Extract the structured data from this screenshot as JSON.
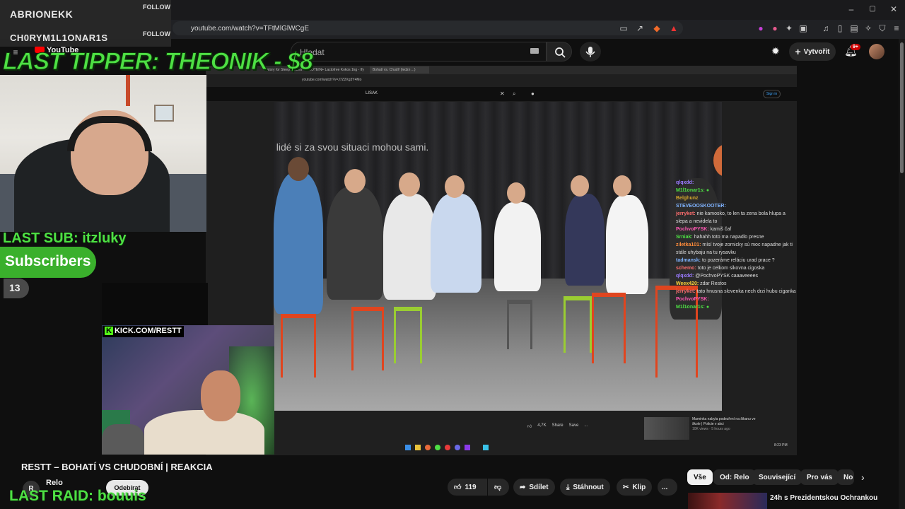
{
  "browser": {
    "url": "youtube.com/watch?v=TFtMlGlWCgE",
    "window_controls": [
      "–",
      "▢",
      "✕"
    ]
  },
  "overlay": {
    "follows": [
      {
        "name": "ABRIONEKK",
        "label": "FOLLOW"
      },
      {
        "name": "CH0RYM1L1ONAR1S",
        "label": "FOLLOW"
      }
    ],
    "last_tipper": "LAST TIPPER: THEONIK - $8",
    "last_sub": "LAST SUB: itzluky",
    "subscribers_label": "Subscribers",
    "subscribers_count": "13",
    "kick_tag": "KICK.COM/RESTT",
    "last_raid": "LAST RAID: bouuis"
  },
  "youtube_header": {
    "logo": "YouTube",
    "search_placeholder": "Hledat",
    "create_label": "Vytvořit",
    "notif_badge": "9+"
  },
  "inner_screen": {
    "tabs": [
      "History for Sleep Shares",
      "PROTEIN+ Lactofree Kokos 1kg - Ify",
      "Bohatí vs. Chudí! (ledzn ...)"
    ],
    "url": "youtube.com/watch?v=J7Z2Xg3Y4Mo",
    "search_value": "LISAK",
    "sign_in": "Sign in",
    "caption": "í lidé si za svou situaci mohou sami.",
    "chat": [
      {
        "user": "qlqxdd:",
        "msg": "",
        "color": "#9b7bff"
      },
      {
        "user": "M1l1onar1s:",
        "msg": "",
        "color": "#4ee044"
      },
      {
        "user": "Belghunz",
        "msg": "",
        "color": "#d4a72c"
      },
      {
        "user": "STEVEOOSKOOTER:",
        "msg": "",
        "color": "#7fb3ff"
      },
      {
        "user": "jerryket:",
        "msg": "nie kamosko, to len ta zena bola hlupa a slepa a nevidela to",
        "color": "#ff6e6e"
      },
      {
        "user": "PochvoPYSK:",
        "msg": "kamiš čaf",
        "color": "#ff59b4"
      },
      {
        "user": "Srniak:",
        "msg": "hahahh toto ma napadlo presne",
        "color": "#4ee044"
      },
      {
        "user": "ziletka101:",
        "msg": "mísí tvoje zornicky sú moc napadne jak ti stále uhybaju na tu rysavku",
        "color": "#ff8c3a"
      },
      {
        "user": "tadmansk:",
        "msg": "to pozeráme reláciu urad prace ?",
        "color": "#7fb3ff"
      },
      {
        "user": "schemo:",
        "msg": "toto je celkom sikovna cigoska",
        "color": "#ff6e6e"
      },
      {
        "user": "qlqxdd:",
        "msg": "@PochvoPYSK caaaveeees",
        "color": "#9b7bff"
      },
      {
        "user": "Weex420:",
        "msg": "zdar Restos",
        "color": "#ffd23a"
      },
      {
        "user": "jerryket:",
        "msg": "tato hnusna slovenka nech drzi hubu ciganka",
        "color": "#ff6e6e"
      },
      {
        "user": "PochvoPYSK:",
        "msg": "",
        "color": "#ff59b4"
      },
      {
        "user": "M1l1onar1s:",
        "msg": "",
        "color": "#4ee044"
      }
    ],
    "actions": [
      "4,7K",
      "Share",
      "Save",
      "..."
    ],
    "rec_title": "Maminka nabyla podezření na šikanu ve škole | Policie v akci",
    "rec_meta": "10K views · 5 hours ago",
    "clock": "8:23 PM"
  },
  "video": {
    "title": "RESTT – BOHATÍ VS CHUDOBNÍ | REAKCIA",
    "channel": "Relo",
    "avatar_letter": "R",
    "subscribe_label": "Odebírat",
    "likes": "119",
    "share_label": "Sdílet",
    "download_label": "Stáhnout",
    "clip_label": "Klip",
    "more_label": "..."
  },
  "chips": [
    "Vše",
    "Od: Relo",
    "Související",
    "Pro vás",
    "No"
  ],
  "recommendation": {
    "title": "24h s Prezidentskou Ochrankou"
  }
}
